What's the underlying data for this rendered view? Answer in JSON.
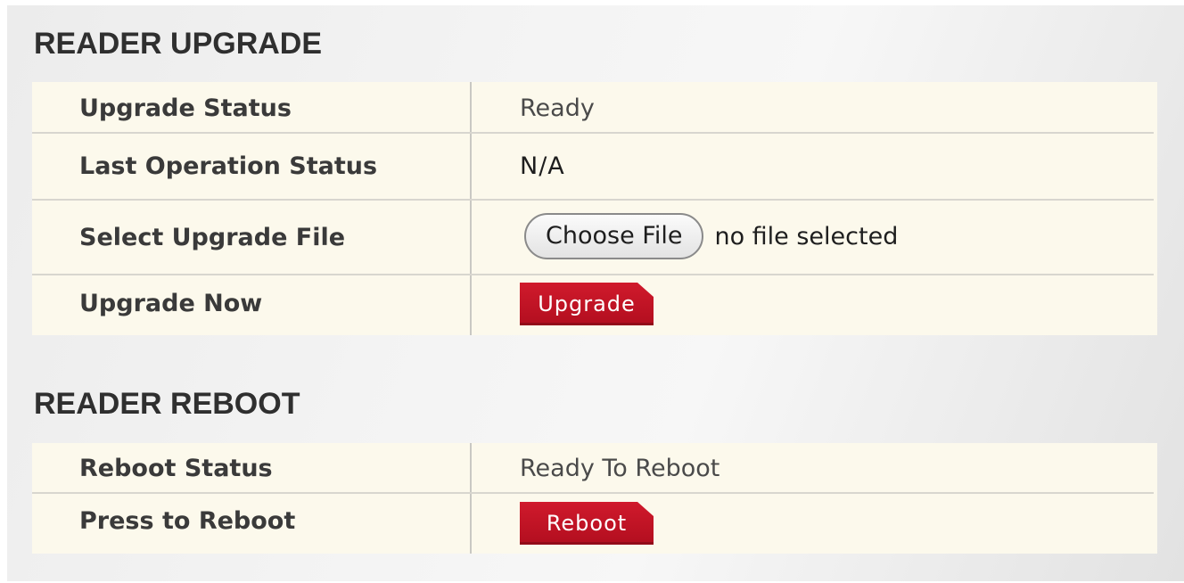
{
  "upgrade_section": {
    "title": "READER UPGRADE",
    "rows": {
      "status": {
        "label": "Upgrade Status",
        "value": "Ready"
      },
      "last_operation": {
        "label": "Last Operation Status",
        "value": "N/A"
      },
      "select_file": {
        "label": "Select Upgrade File",
        "button_label": "Choose File",
        "file_status": "no file selected"
      },
      "upgrade_now": {
        "label": "Upgrade Now",
        "button_label": "Upgrade"
      }
    }
  },
  "reboot_section": {
    "title": "READER REBOOT",
    "rows": {
      "status": {
        "label": "Reboot Status",
        "value": "Ready To Reboot"
      },
      "press": {
        "label": "Press to Reboot",
        "button_label": "Reboot"
      }
    }
  },
  "colors": {
    "table_background": "#fcf9ec",
    "action_button": "#c8142a",
    "title_text": "#2f2f2f"
  }
}
